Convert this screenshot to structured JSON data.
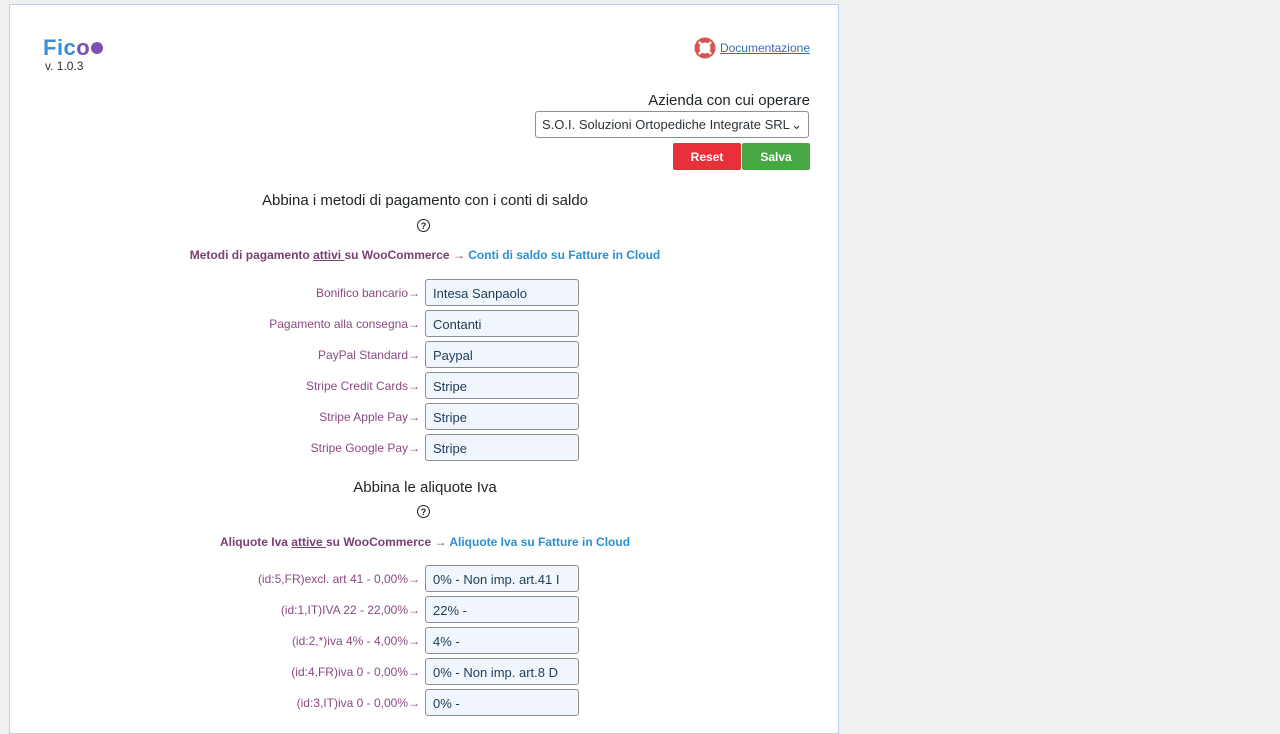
{
  "header": {
    "logo_main": "Fic",
    "logo_o": "o",
    "version": "v. 1.0.3",
    "doc_link": "Documentazione"
  },
  "company": {
    "label": "Azienda con cui operare",
    "selected": "S.O.I. Soluzioni Ortopediche Integrate SRL",
    "reset": "Reset",
    "save": "Salva"
  },
  "payments": {
    "title": "Abbina i metodi di pagamento con i conti di saldo",
    "sub_pre": "Metodi di pagamento ",
    "sub_u": "attivi ",
    "sub_post": "su WooCommerce → ",
    "sub_target": "Conti di saldo su Fatture in Cloud",
    "rows": [
      {
        "label": "Bonifico bancario→",
        "value": "Intesa Sanpaolo"
      },
      {
        "label": "Pagamento alla consegna→",
        "value": "Contanti"
      },
      {
        "label": "PayPal Standard→",
        "value": "Paypal"
      },
      {
        "label": "Stripe Credit Cards→",
        "value": "Stripe"
      },
      {
        "label": "Stripe Apple Pay→",
        "value": "Stripe"
      },
      {
        "label": "Stripe Google Pay→",
        "value": "Stripe"
      }
    ]
  },
  "vat": {
    "title": "Abbina le aliquote Iva",
    "sub_pre": "Aliquote Iva ",
    "sub_u": "attive ",
    "sub_post": "su WooCommerce → ",
    "sub_target": "Aliquote Iva su Fatture in Cloud",
    "rows": [
      {
        "label": "(id:5,FR)excl. art 41 - 0,00%→",
        "value": "0% - Non imp. art.41 I"
      },
      {
        "label": "(id:1,IT)IVA 22 - 22,00%→",
        "value": "22% -"
      },
      {
        "label": "(id:2,*)iva 4% - 4,00%→",
        "value": "4% -"
      },
      {
        "label": "(id:4,FR)iva 0 - 0,00%→",
        "value": "0% - Non imp. art.8 D"
      },
      {
        "label": "(id:3,IT)iva 0 - 0,00%→",
        "value": "0% -"
      }
    ]
  }
}
